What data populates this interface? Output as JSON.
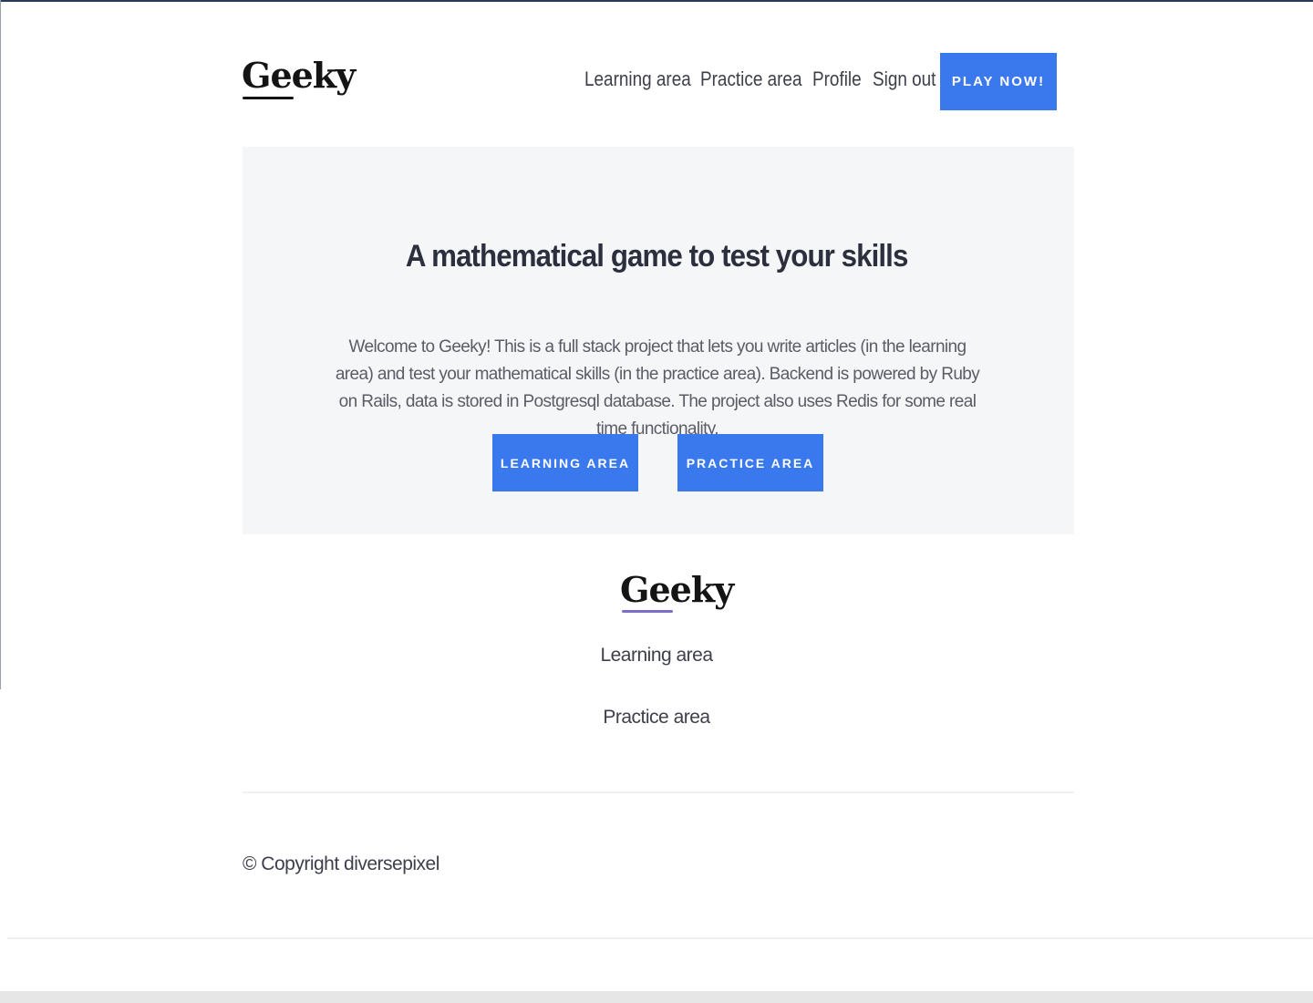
{
  "header": {
    "logo": "Geeky",
    "nav": [
      {
        "label": "Learning area"
      },
      {
        "label": "Practice area"
      },
      {
        "label": "Profile"
      },
      {
        "label": "Sign out"
      }
    ],
    "cta_label": "PLAY NOW!"
  },
  "hero": {
    "title": "A mathematical game to test your skills",
    "description": "Welcome to Geeky! This is a full stack project that lets you write articles (in the learning area) and test your mathematical skills (in the practice area). Backend is powered by Ruby on Rails, data is stored in Postgresql database. The project also uses Redis for some real time functionality.",
    "buttons": [
      {
        "label": "LEARNING AREA"
      },
      {
        "label": "PRACTICE AREA"
      }
    ]
  },
  "footer": {
    "logo": "Geeky",
    "links": [
      {
        "label": "Learning area"
      },
      {
        "label": "Practice area"
      }
    ],
    "copyright": "© Copyright diversepixel"
  },
  "colors": {
    "accent": "#3a78ee",
    "hero_background": "#f5f6f8",
    "text": "#3d3f4a",
    "heading": "#2c2f3d"
  }
}
